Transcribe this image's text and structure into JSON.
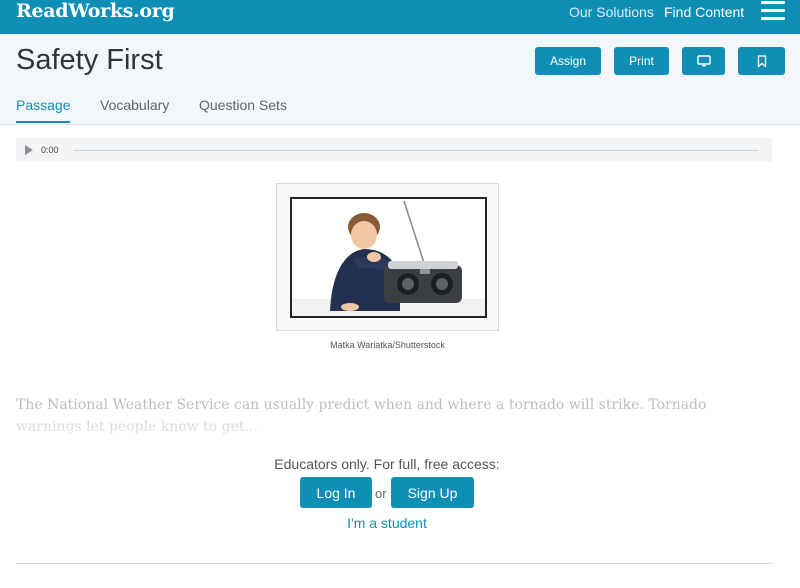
{
  "brand": {
    "logo": "ReadWorks.org",
    "accent": "#0f8fb6"
  },
  "nav": {
    "solutions": "Our Solutions",
    "find_content": "Find Content",
    "menu_icon": "hamburger-icon"
  },
  "header": {
    "title": "Safety First",
    "assign": "Assign",
    "print": "Print",
    "projector_icon": "monitor-icon",
    "bookmark_icon": "bookmark-icon"
  },
  "tabs": [
    "Passage",
    "Vocabulary",
    "Question Sets"
  ],
  "audio": {
    "time": "0:00",
    "play_icon": "play-icon"
  },
  "figure": {
    "caption": "Matka Wariatka/Shutterstock"
  },
  "passage": {
    "text": "The National Weather Service can usually predict when and where a tornado will strike. Tornado warnings let people know to get..."
  },
  "access": {
    "message": "Educators only. For full, free access:",
    "login": "Log In",
    "or": "or",
    "signup": "Sign Up",
    "student": "I'm a student"
  }
}
